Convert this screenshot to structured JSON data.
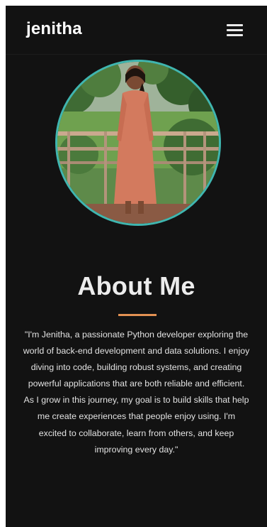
{
  "navbar": {
    "brand": "jenitha",
    "menu_icon": "hamburger-menu-icon"
  },
  "profile": {
    "photo_border_color": "#3fb6b0"
  },
  "about": {
    "heading": "About Me",
    "accent_color": "#e39152",
    "bio": "\"I'm Jenitha, a passionate Python developer exploring the world of back-end development and data solutions. I enjoy diving into code, building robust systems, and creating powerful applications that are both reliable and efficient. As I grow in this journey, my goal is to build skills that help me create experiences that people enjoy using. I'm excited to collaborate, learn from others, and keep improving every day.\""
  },
  "colors": {
    "background": "#121212",
    "text": "#ececec"
  }
}
